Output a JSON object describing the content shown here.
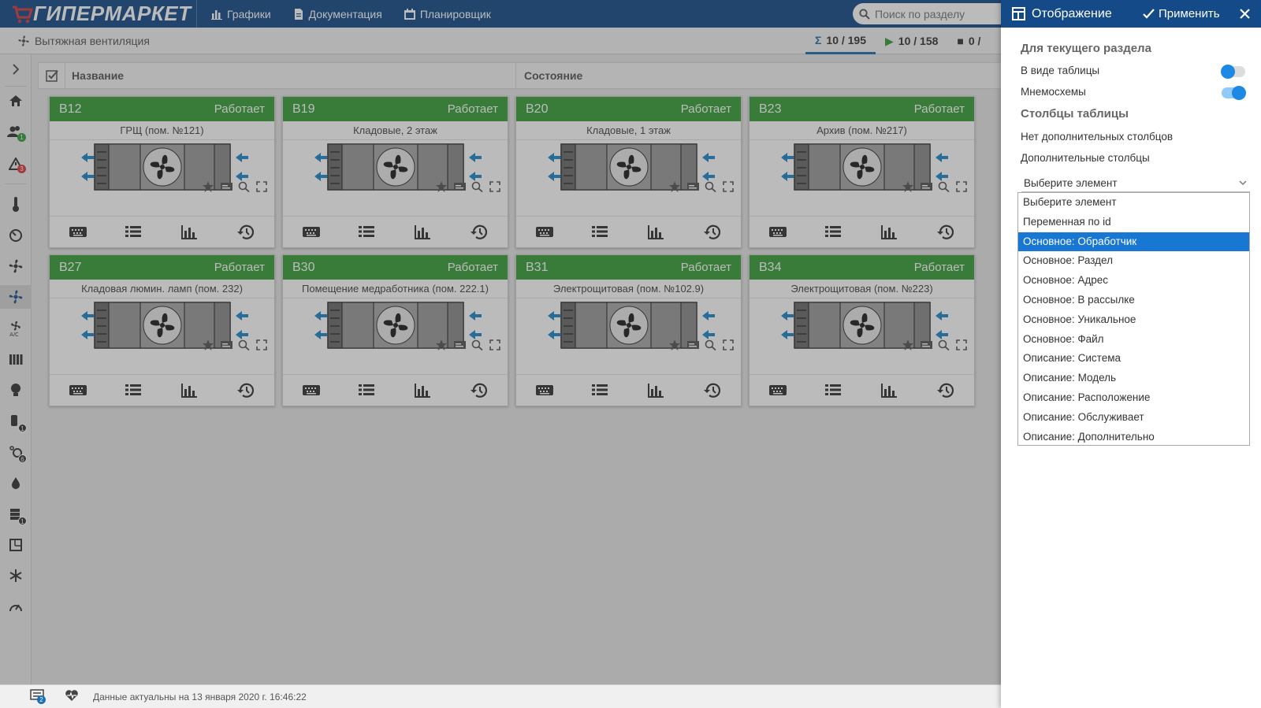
{
  "header": {
    "logo": "ГИПЕРМАРКЕТ",
    "nav": [
      {
        "label": "Графики",
        "icon": "bar-chart-icon"
      },
      {
        "label": "Документация",
        "icon": "document-icon"
      },
      {
        "label": "Планировщик",
        "icon": "calendar-icon"
      }
    ],
    "search_placeholder": "Поиск по разделу"
  },
  "subbar": {
    "title": "Вытяжная вентиляция",
    "counters": [
      {
        "symbol": "Σ",
        "value": "10 / 195"
      },
      {
        "symbol": "▶",
        "value": "10 / 158"
      },
      {
        "symbol": "■",
        "value": "0 /"
      }
    ]
  },
  "table": {
    "col_name": "Название",
    "col_state": "Состояние"
  },
  "cards": [
    {
      "id": "B12",
      "status": "Работает",
      "location": "ГРЩ (пом. №121)"
    },
    {
      "id": "B19",
      "status": "Работает",
      "location": "Кладовые, 2 этаж"
    },
    {
      "id": "B20",
      "status": "Работает",
      "location": "Кладовые, 1 этаж"
    },
    {
      "id": "B23",
      "status": "Работает",
      "location": "Архив (пом. №217)"
    },
    {
      "id": "B27",
      "status": "Работает",
      "location": "Кладовая люмин. ламп (пом. 232)"
    },
    {
      "id": "B30",
      "status": "Работает",
      "location": "Помещение медработника (пом. 222.1)"
    },
    {
      "id": "B31",
      "status": "Работает",
      "location": "Электрощитовая (пом. №102.9)"
    },
    {
      "id": "B34",
      "status": "Работает",
      "location": "Электрощитовая (пом. №223)"
    }
  ],
  "sidebar_badges": {
    "users": "1",
    "alarms": "3",
    "s1": "1",
    "s2": "6",
    "s3": "1"
  },
  "footer": {
    "messages_badge": "2",
    "status_text": "Данные актуальны на 13 января 2020 г. 16:46:22"
  },
  "panel": {
    "title": "Отображение",
    "apply_label": "Применить",
    "section_current": "Для текущего раздела",
    "toggle_table_label": "В виде таблицы",
    "toggle_table_on": false,
    "toggle_schemes_label": "Мнемосхемы",
    "toggle_schemes_on": true,
    "section_columns": "Столбцы таблицы",
    "no_extra_columns": "Нет дополнительных столбцов",
    "extra_columns_label": "Дополнительные столбцы",
    "select_value": "Выберите элемент",
    "options": [
      "Выберите элемент",
      "Переменная по id",
      "Основное: Обработчик",
      "Основное: Раздел",
      "Основное: Адрес",
      "Основное: В рассылке",
      "Основное: Уникальное",
      "Основное: Файл",
      "Описание: Система",
      "Описание: Модель",
      "Описание: Расположение",
      "Описание: Обслуживает",
      "Описание: Дополнительно"
    ],
    "selected_option": "Основное: Обработчик"
  },
  "colors": {
    "brand": "#134a87",
    "card_ok": "#389f3a",
    "accent": "#1877d2"
  }
}
